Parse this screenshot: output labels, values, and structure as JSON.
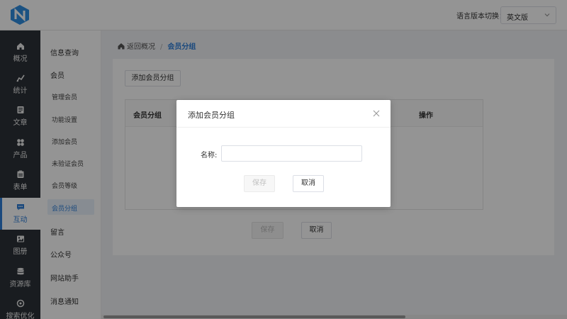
{
  "header": {
    "logo_icon": "n-logo-icon",
    "lang_label": "语言版本切换：",
    "lang_selected": "英文版"
  },
  "sidebar": {
    "items": [
      {
        "label": "概况",
        "icon": "home-icon"
      },
      {
        "label": "统计",
        "icon": "stats-icon"
      },
      {
        "label": "文章",
        "icon": "article-icon"
      },
      {
        "label": "产品",
        "icon": "product-icon"
      },
      {
        "label": "表单",
        "icon": "form-icon"
      },
      {
        "label": "互动",
        "icon": "chat-icon"
      },
      {
        "label": "图册",
        "icon": "album-icon"
      },
      {
        "label": "资源库",
        "icon": "database-icon"
      },
      {
        "label": "搜索优化",
        "icon": "seo-icon"
      }
    ],
    "active_label": "互动"
  },
  "subnav": {
    "items": [
      {
        "label": "信息查询"
      },
      {
        "label": "会员"
      },
      {
        "label": "管理会员"
      },
      {
        "label": "功能设置"
      },
      {
        "label": "添加会员"
      },
      {
        "label": "未验证会员"
      },
      {
        "label": "会员等级"
      },
      {
        "label": "会员分组"
      },
      {
        "label": "留言"
      },
      {
        "label": "公众号"
      },
      {
        "label": "网站助手"
      },
      {
        "label": "消息通知"
      }
    ]
  },
  "breadcrumb": {
    "back": "返回概况",
    "sep": "/",
    "current": "会员分组"
  },
  "main": {
    "add_group_button": "添加会员分组",
    "columns": [
      "会员分组",
      "操作"
    ],
    "save_label": "保存",
    "cancel_label": "取消"
  },
  "modal": {
    "title": "添加会员分组",
    "name_label": "名称:",
    "name_value": "",
    "save_label": "保存",
    "cancel_label": "取消"
  },
  "colors": {
    "accent": "#2f7fd8",
    "sidebar_bg": "#2c3138"
  }
}
